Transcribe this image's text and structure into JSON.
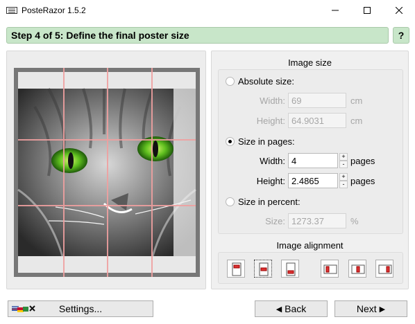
{
  "window": {
    "title": "PosteRazor 1.5.2",
    "icons": [
      "app-icon",
      "minimize-icon",
      "maximize-icon",
      "close-icon"
    ]
  },
  "step": {
    "title": "Step 4 of 5: Define the final poster size",
    "help_label": "?",
    "color": "#c8e6c9"
  },
  "preview": {
    "image": "cat face with green eyes",
    "grid_color": "#f0a0a0",
    "columns": 4,
    "rows": 3
  },
  "image_size": {
    "title": "Image size",
    "absolute": {
      "label": "Absolute size:",
      "checked": false,
      "width_label": "Width:",
      "width_value": "69",
      "width_unit": "cm",
      "height_label": "Height:",
      "height_value": "64.9031",
      "height_unit": "cm"
    },
    "pages": {
      "label": "Size in pages:",
      "checked": true,
      "width_label": "Width:",
      "width_value": "4",
      "width_unit": "pages",
      "height_label": "Height:",
      "height_value": "2.4865",
      "height_unit": "pages"
    },
    "percent": {
      "label": "Size in percent:",
      "checked": false,
      "size_label": "Size:",
      "size_value": "1273.37",
      "size_unit": "%"
    }
  },
  "image_alignment": {
    "title": "Image alignment",
    "buttons": [
      "align-top",
      "align-middle",
      "align-bottom",
      "align-left",
      "align-center",
      "align-right"
    ],
    "selected": "align-middle"
  },
  "footer": {
    "settings_label": "Settings...",
    "back_label": "Back",
    "next_label": "Next"
  }
}
